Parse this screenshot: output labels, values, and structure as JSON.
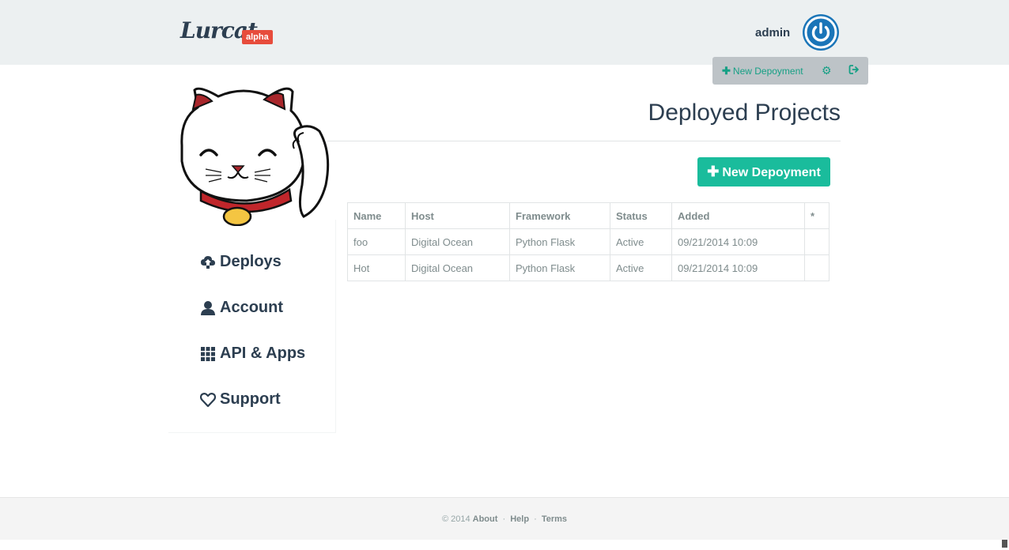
{
  "header": {
    "logo_text": "Lurcat",
    "badge": "alpha",
    "username": "admin"
  },
  "user_menu": {
    "new_label": "New Depoyment",
    "icons": [
      "gear-icon",
      "sign-out-icon"
    ]
  },
  "sidebar": {
    "items": [
      {
        "label": "Deploys",
        "icon": "cloud-upload-icon"
      },
      {
        "label": "Account",
        "icon": "user-icon"
      },
      {
        "label": "API & Apps",
        "icon": "grid-icon"
      },
      {
        "label": "Support",
        "icon": "heart-icon"
      }
    ]
  },
  "main": {
    "title": "Deployed Projects",
    "new_button": "New Depoyment",
    "table": {
      "headers": [
        "Name",
        "Host",
        "Framework",
        "Status",
        "Added",
        "*"
      ],
      "rows": [
        [
          "foo",
          "Digital Ocean",
          "Python Flask",
          "Active",
          "09/21/2014 10:09",
          ""
        ],
        [
          "Hot",
          "Digital Ocean",
          "Python Flask",
          "Active",
          "09/21/2014 10:09",
          ""
        ]
      ]
    }
  },
  "footer": {
    "copyright": "© 2014",
    "links": [
      "About",
      "Help",
      "Terms"
    ],
    "separator": "·"
  },
  "colors": {
    "accent": "#1abc9c",
    "badge": "#e74c3c",
    "power": "#1a75b8",
    "text": "#2c3e50"
  }
}
